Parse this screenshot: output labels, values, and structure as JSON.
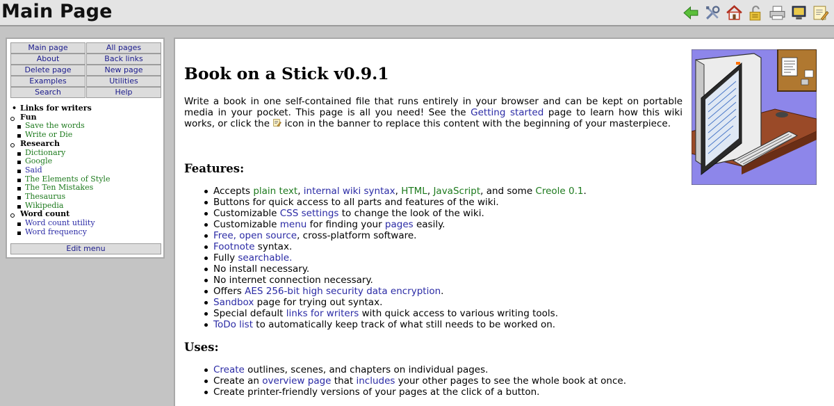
{
  "header": {
    "title": "Main Page",
    "toolbar": [
      "back-icon",
      "tools-icon",
      "home-icon",
      "lock-icon",
      "print-icon",
      "monitor-icon",
      "edit-icon"
    ]
  },
  "sidebar": {
    "menu": [
      "Main page",
      "All pages",
      "About",
      "Back links",
      "Delete page",
      "New page",
      "Examples",
      "Utilities",
      "Search",
      "Help"
    ],
    "tree": {
      "root": "Links for writers",
      "fun": {
        "label": "Fun",
        "items": [
          "Save the words",
          "Write or Die"
        ]
      },
      "research": {
        "label": "Research",
        "items": [
          "Dictionary",
          "Google",
          "Said",
          "The Elements of Style",
          "The Ten Mistakes",
          "Thesaurus",
          "Wikipedia"
        ]
      },
      "wordcount": {
        "label": "Word count",
        "items": [
          "Word count utility",
          "Word frequency"
        ]
      }
    },
    "edit_menu": "Edit menu"
  },
  "main": {
    "heading": "Book on a Stick v0.9.1",
    "intro": {
      "p1": "Write a book in one self-contained file that runs entirely in your browser and can be kept on portable media in your pocket. This page is all you need! See the ",
      "link1": "Getting started",
      "p2": " page to learn how this wiki works, or click the ",
      "p3": " icon in the banner to replace this content with the beginning of your masterpiece."
    },
    "features_heading": "Features:",
    "features": {
      "f1": {
        "a": "Accepts ",
        "l1": "plain text",
        "s1": ", ",
        "l2": "internal wiki syntax",
        "s2": ", ",
        "l3": "HTML",
        "s3": ", ",
        "l4": "JavaScript",
        "s4": ", and some ",
        "l5": "Creole 0.1",
        "s5": "."
      },
      "f2": "Buttons for quick access to all parts and features of the wiki.",
      "f3": {
        "a": "Customizable ",
        "l": "CSS settings",
        "b": " to change the look of the wiki."
      },
      "f4": {
        "a": "Customizable ",
        "l1": "menu",
        "b": " for finding your ",
        "l2": "pages",
        "c": " easily."
      },
      "f5": {
        "l1": "Free",
        "s": ", ",
        "l2": "open source",
        "b": ", cross-platform software."
      },
      "f6": {
        "l": "Footnote",
        "b": " syntax."
      },
      "f7": {
        "a": "Fully ",
        "l": "searchable",
        "b": "."
      },
      "f8": "No install necessary.",
      "f9": "No internet connection necessary.",
      "f10": {
        "a": "Offers ",
        "l": "AES 256-bit high security data encryption",
        "b": "."
      },
      "f11": {
        "l": "Sandbox",
        "b": " page for trying out syntax."
      },
      "f12": {
        "a": "Special default ",
        "l": "links for writers",
        "b": " with quick access to various writing tools."
      },
      "f13": {
        "l": "ToDo list",
        "b": " to automatically keep track of what still needs to be worked on."
      }
    },
    "uses_heading": "Uses:",
    "uses": {
      "u1": {
        "l": "Create",
        "b": " outlines, scenes, and chapters on individual pages."
      },
      "u2": {
        "a": "Create an ",
        "l1": "overview page",
        "b": " that ",
        "l2": "includes",
        "c": " your other pages to see the whole book at once."
      },
      "u3": "Create printer-friendly versions of your pages at the click of a button."
    }
  }
}
